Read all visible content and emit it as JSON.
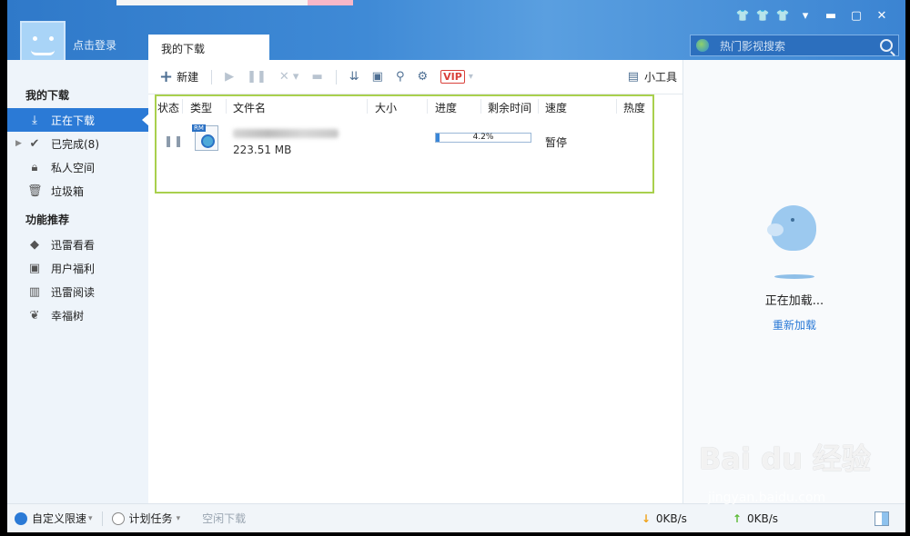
{
  "header": {
    "login_label": "点击登录",
    "active_tab": "我的下载",
    "search_placeholder": "热门影视搜索",
    "window_controls": [
      "shirt-icon",
      "shirt-icon",
      "shirt-icon",
      "menu-icon",
      "minimize-icon",
      "maximize-icon",
      "close-icon"
    ]
  },
  "sidebar": {
    "group1": "我的下载",
    "items1": [
      {
        "label": "正在下载",
        "icon": "download-icon",
        "active": true
      },
      {
        "label": "已完成(8)",
        "icon": "check-icon"
      },
      {
        "label": "私人空间",
        "icon": "lock-icon"
      },
      {
        "label": "垃圾箱",
        "icon": "trash-icon"
      }
    ],
    "group2": "功能推荐",
    "items2": [
      {
        "label": "迅雷看看",
        "icon": "shield-icon"
      },
      {
        "label": "用户福利",
        "icon": "gift-icon"
      },
      {
        "label": "迅雷阅读",
        "icon": "book-icon"
      },
      {
        "label": "幸福树",
        "icon": "leaf-icon"
      }
    ]
  },
  "toolbar": {
    "new_label": "新建",
    "tools_label": "小工具",
    "vip_label": "VIP"
  },
  "table": {
    "columns": [
      "状态",
      "类型",
      "文件名",
      "大小",
      "进度",
      "剩余时间",
      "速度",
      "热度"
    ],
    "rows": [
      {
        "size": "223.51 MB",
        "progress_text": "4.2%",
        "progress": 0.042,
        "speed": "暂停",
        "type_tag": "RM"
      }
    ]
  },
  "right_panel": {
    "loading_text": "正在加载...",
    "reload_label": "重新加载"
  },
  "statusbar": {
    "speed_limit": "自定义限速",
    "schedule": "计划任务",
    "idle_download": "空闲下载",
    "down_speed": "0KB/s",
    "up_speed": "0KB/s"
  },
  "watermark": {
    "brand": "Bai du 经验",
    "url": "jingyan.baidu.com"
  },
  "colors": {
    "accent": "#2b7ad6",
    "highlight_border": "#a9d04d"
  }
}
